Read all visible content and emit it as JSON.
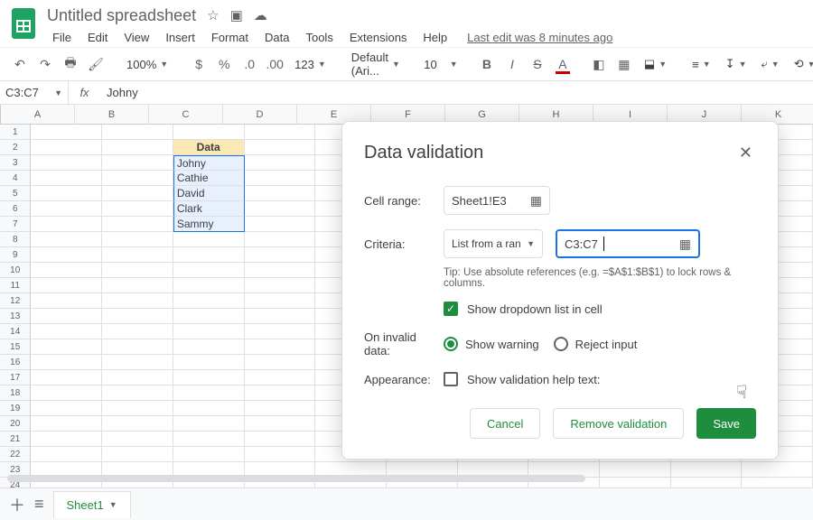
{
  "doc": {
    "title": "Untitled spreadsheet"
  },
  "menu": {
    "file": "File",
    "edit": "Edit",
    "view": "View",
    "insert": "Insert",
    "format": "Format",
    "data": "Data",
    "tools": "Tools",
    "extensions": "Extensions",
    "help": "Help",
    "history": "Last edit was 8 minutes ago"
  },
  "toolbar": {
    "zoom": "100%",
    "font": "Default (Ari...",
    "fontsize": "10",
    "numfmt": "123"
  },
  "namebox": "C3:C7",
  "formula": "Johny",
  "columns": [
    "A",
    "B",
    "C",
    "D",
    "E",
    "F",
    "G",
    "H",
    "I",
    "J",
    "K"
  ],
  "rows_count": 25,
  "cells": {
    "C1": "Data",
    "C2": "Johny",
    "C3": "Cathie",
    "C4": "David",
    "C5": "Clark",
    "C6": "Sammy"
  },
  "dialog": {
    "title": "Data validation",
    "cell_range_label": "Cell range:",
    "cell_range_value": "Sheet1!E3",
    "criteria_label": "Criteria:",
    "criteria_type": "List from a range",
    "criteria_value": "C3:C7",
    "hint": "Tip: Use absolute references (e.g. =$A$1:$B$1) to lock rows & columns.",
    "show_dropdown": "Show dropdown list in cell",
    "invalid_label": "On invalid data:",
    "show_warning": "Show warning",
    "reject_input": "Reject input",
    "appearance_label": "Appearance:",
    "show_help": "Show validation help text:",
    "cancel": "Cancel",
    "remove": "Remove validation",
    "save": "Save"
  },
  "sheet": {
    "name": "Sheet1"
  }
}
